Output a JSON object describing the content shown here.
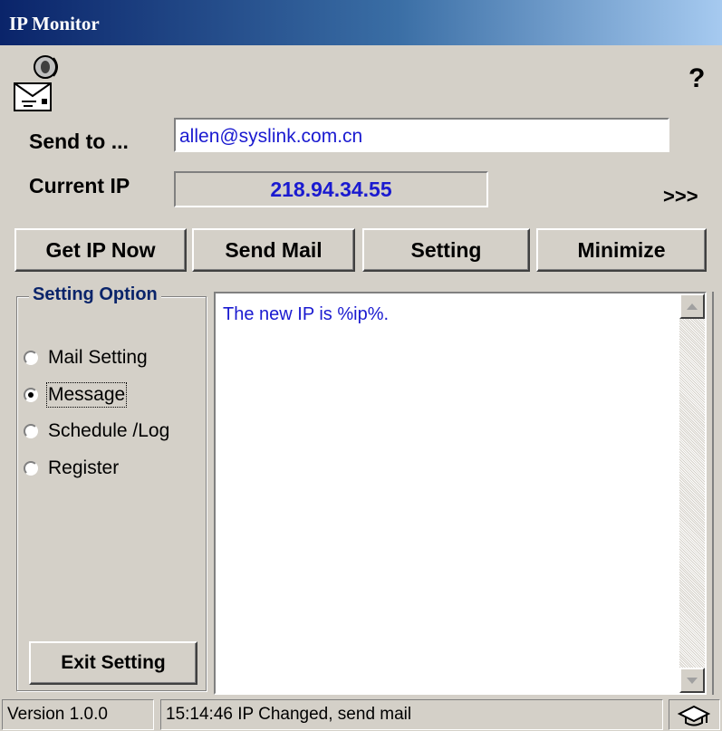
{
  "window": {
    "title": "IP Monitor"
  },
  "header": {
    "help_label": "?",
    "expand_label": ">>>",
    "mail_icon": "mail-speaker-icon"
  },
  "form": {
    "send_to_label": "Send to ...",
    "send_to_value": "allen@syslink.com.cn",
    "current_ip_label": "Current IP",
    "current_ip_value": "218.94.34.55"
  },
  "toolbar": {
    "get_ip_label": "Get IP Now",
    "send_mail_label": "Send Mail",
    "setting_label": "Setting",
    "minimize_label": "Minimize"
  },
  "settings": {
    "group_title": "Setting Option",
    "options": [
      {
        "label": "Mail Setting",
        "selected": false
      },
      {
        "label": "Message",
        "selected": true
      },
      {
        "label": "Schedule /Log",
        "selected": false
      },
      {
        "label": "Register",
        "selected": false
      }
    ],
    "exit_label": "Exit Setting"
  },
  "message": {
    "text": "The new IP is %ip%."
  },
  "status": {
    "version": "Version 1.0.0",
    "log": "15:14:46 IP Changed, send mail",
    "tray_icon": "cap-icon"
  },
  "colors": {
    "ip_text": "#1a1ad0",
    "group_title": "#0a246a",
    "titlebar_start": "#0a246a",
    "titlebar_end": "#a6caf0"
  }
}
